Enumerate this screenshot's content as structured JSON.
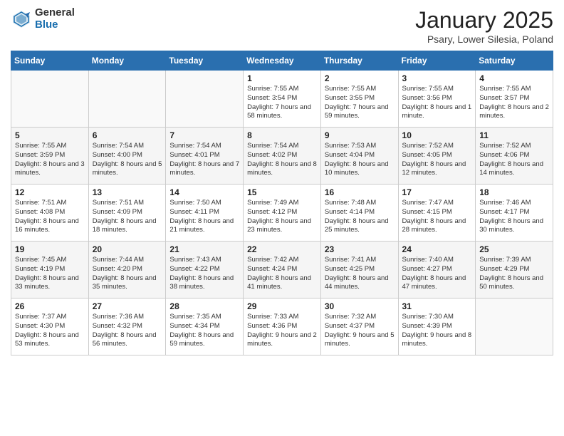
{
  "header": {
    "logo_general": "General",
    "logo_blue": "Blue",
    "month_title": "January 2025",
    "location": "Psary, Lower Silesia, Poland"
  },
  "weekdays": [
    "Sunday",
    "Monday",
    "Tuesday",
    "Wednesday",
    "Thursday",
    "Friday",
    "Saturday"
  ],
  "weeks": [
    [
      {
        "day": "",
        "info": ""
      },
      {
        "day": "",
        "info": ""
      },
      {
        "day": "",
        "info": ""
      },
      {
        "day": "1",
        "info": "Sunrise: 7:55 AM\nSunset: 3:54 PM\nDaylight: 7 hours\nand 58 minutes."
      },
      {
        "day": "2",
        "info": "Sunrise: 7:55 AM\nSunset: 3:55 PM\nDaylight: 7 hours\nand 59 minutes."
      },
      {
        "day": "3",
        "info": "Sunrise: 7:55 AM\nSunset: 3:56 PM\nDaylight: 8 hours\nand 1 minute."
      },
      {
        "day": "4",
        "info": "Sunrise: 7:55 AM\nSunset: 3:57 PM\nDaylight: 8 hours\nand 2 minutes."
      }
    ],
    [
      {
        "day": "5",
        "info": "Sunrise: 7:55 AM\nSunset: 3:59 PM\nDaylight: 8 hours\nand 3 minutes."
      },
      {
        "day": "6",
        "info": "Sunrise: 7:54 AM\nSunset: 4:00 PM\nDaylight: 8 hours\nand 5 minutes."
      },
      {
        "day": "7",
        "info": "Sunrise: 7:54 AM\nSunset: 4:01 PM\nDaylight: 8 hours\nand 7 minutes."
      },
      {
        "day": "8",
        "info": "Sunrise: 7:54 AM\nSunset: 4:02 PM\nDaylight: 8 hours\nand 8 minutes."
      },
      {
        "day": "9",
        "info": "Sunrise: 7:53 AM\nSunset: 4:04 PM\nDaylight: 8 hours\nand 10 minutes."
      },
      {
        "day": "10",
        "info": "Sunrise: 7:52 AM\nSunset: 4:05 PM\nDaylight: 8 hours\nand 12 minutes."
      },
      {
        "day": "11",
        "info": "Sunrise: 7:52 AM\nSunset: 4:06 PM\nDaylight: 8 hours\nand 14 minutes."
      }
    ],
    [
      {
        "day": "12",
        "info": "Sunrise: 7:51 AM\nSunset: 4:08 PM\nDaylight: 8 hours\nand 16 minutes."
      },
      {
        "day": "13",
        "info": "Sunrise: 7:51 AM\nSunset: 4:09 PM\nDaylight: 8 hours\nand 18 minutes."
      },
      {
        "day": "14",
        "info": "Sunrise: 7:50 AM\nSunset: 4:11 PM\nDaylight: 8 hours\nand 21 minutes."
      },
      {
        "day": "15",
        "info": "Sunrise: 7:49 AM\nSunset: 4:12 PM\nDaylight: 8 hours\nand 23 minutes."
      },
      {
        "day": "16",
        "info": "Sunrise: 7:48 AM\nSunset: 4:14 PM\nDaylight: 8 hours\nand 25 minutes."
      },
      {
        "day": "17",
        "info": "Sunrise: 7:47 AM\nSunset: 4:15 PM\nDaylight: 8 hours\nand 28 minutes."
      },
      {
        "day": "18",
        "info": "Sunrise: 7:46 AM\nSunset: 4:17 PM\nDaylight: 8 hours\nand 30 minutes."
      }
    ],
    [
      {
        "day": "19",
        "info": "Sunrise: 7:45 AM\nSunset: 4:19 PM\nDaylight: 8 hours\nand 33 minutes."
      },
      {
        "day": "20",
        "info": "Sunrise: 7:44 AM\nSunset: 4:20 PM\nDaylight: 8 hours\nand 35 minutes."
      },
      {
        "day": "21",
        "info": "Sunrise: 7:43 AM\nSunset: 4:22 PM\nDaylight: 8 hours\nand 38 minutes."
      },
      {
        "day": "22",
        "info": "Sunrise: 7:42 AM\nSunset: 4:24 PM\nDaylight: 8 hours\nand 41 minutes."
      },
      {
        "day": "23",
        "info": "Sunrise: 7:41 AM\nSunset: 4:25 PM\nDaylight: 8 hours\nand 44 minutes."
      },
      {
        "day": "24",
        "info": "Sunrise: 7:40 AM\nSunset: 4:27 PM\nDaylight: 8 hours\nand 47 minutes."
      },
      {
        "day": "25",
        "info": "Sunrise: 7:39 AM\nSunset: 4:29 PM\nDaylight: 8 hours\nand 50 minutes."
      }
    ],
    [
      {
        "day": "26",
        "info": "Sunrise: 7:37 AM\nSunset: 4:30 PM\nDaylight: 8 hours\nand 53 minutes."
      },
      {
        "day": "27",
        "info": "Sunrise: 7:36 AM\nSunset: 4:32 PM\nDaylight: 8 hours\nand 56 minutes."
      },
      {
        "day": "28",
        "info": "Sunrise: 7:35 AM\nSunset: 4:34 PM\nDaylight: 8 hours\nand 59 minutes."
      },
      {
        "day": "29",
        "info": "Sunrise: 7:33 AM\nSunset: 4:36 PM\nDaylight: 9 hours\nand 2 minutes."
      },
      {
        "day": "30",
        "info": "Sunrise: 7:32 AM\nSunset: 4:37 PM\nDaylight: 9 hours\nand 5 minutes."
      },
      {
        "day": "31",
        "info": "Sunrise: 7:30 AM\nSunset: 4:39 PM\nDaylight: 9 hours\nand 8 minutes."
      },
      {
        "day": "",
        "info": ""
      }
    ]
  ]
}
